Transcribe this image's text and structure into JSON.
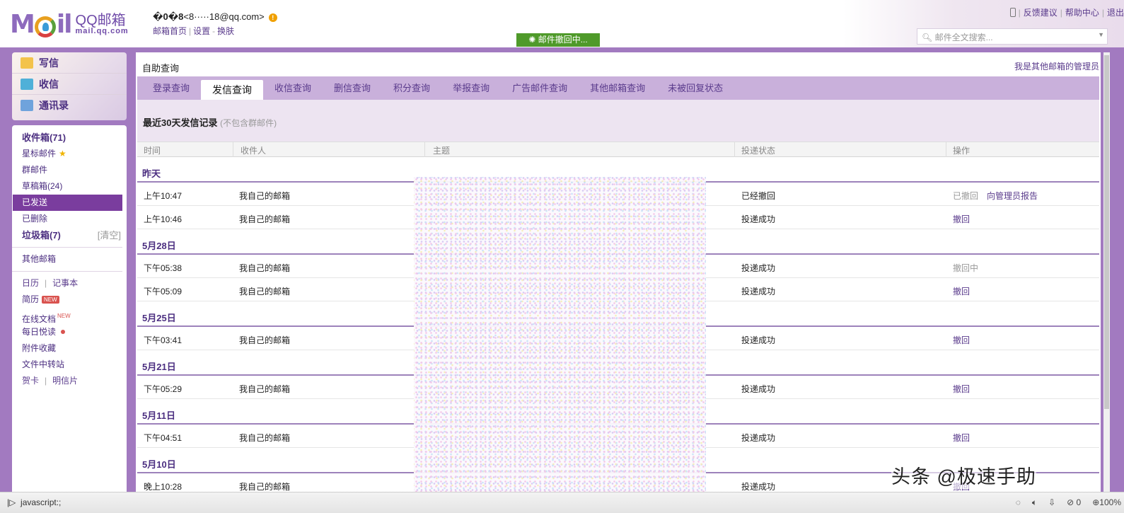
{
  "header": {
    "logo_main": "MOil",
    "logo_title": "QQ邮箱",
    "logo_domain": "mail.qq.com",
    "user_name": "�0�8",
    "user_email": "<8·····18@qq.com>",
    "links": [
      "邮箱首页",
      "设置",
      "换肤"
    ],
    "top_links": [
      "反馈建议",
      "帮助中心",
      "退出"
    ],
    "search_placeholder": "邮件全文搜索...",
    "toast": "邮件撤回中..."
  },
  "sidebar": {
    "quick": [
      "写信",
      "收信",
      "通讯录"
    ],
    "inbox": "收件箱(71)",
    "starred": "星标邮件",
    "group": "群邮件",
    "drafts": "草稿箱(24)",
    "sent": "已发送",
    "deleted": "已删除",
    "spam": "垃圾箱(7)",
    "spam_clear": "[清空]",
    "other": "其他邮箱",
    "calendar": "日历",
    "notes": "记事本",
    "resume": "简历",
    "new": "NEW",
    "docs": "在线文档",
    "daily": "每日悦读",
    "attachments": "附件收藏",
    "transfer": "文件中转站",
    "cards": "贺卡",
    "postcards": "明信片"
  },
  "main": {
    "title": "自助查询",
    "admin_link": "我是其他邮箱的管理员",
    "tabs": [
      "登录查询",
      "发信查询",
      "收信查询",
      "删信查询",
      "积分查询",
      "举报查询",
      "广告邮件查询",
      "其他邮箱查询",
      "未被回复状态"
    ],
    "section_title": "最近30天发信记录",
    "section_note": "(不包含群邮件)",
    "columns": [
      "时间",
      "收件人",
      "主题",
      "投递状态",
      "操作"
    ],
    "groups": [
      {
        "date": "昨天",
        "rows": [
          {
            "time": "上午10:47",
            "to": "我自己的邮箱",
            "status": "已经撤回",
            "action": "已撤回",
            "action2": "向管理员报告"
          },
          {
            "time": "上午10:46",
            "to": "我自己的邮箱",
            "status": "投递成功",
            "action": "撤回"
          }
        ]
      },
      {
        "date": "5月28日",
        "rows": [
          {
            "time": "下午05:38",
            "to": "我自己的邮箱",
            "status": "投递成功",
            "action": "撤回中"
          },
          {
            "time": "下午05:09",
            "to": "我自己的邮箱",
            "status": "投递成功",
            "action": "撤回"
          }
        ]
      },
      {
        "date": "5月25日",
        "rows": [
          {
            "time": "下午03:41",
            "to": "我自己的邮箱",
            "status": "投递成功",
            "action": "撤回"
          }
        ]
      },
      {
        "date": "5月21日",
        "rows": [
          {
            "time": "下午05:29",
            "to": "我自己的邮箱",
            "status": "投递成功",
            "action": "撤回"
          }
        ]
      },
      {
        "date": "5月11日",
        "rows": [
          {
            "time": "下午04:51",
            "to": "我自己的邮箱",
            "status": "投递成功",
            "action": "撤回"
          }
        ]
      },
      {
        "date": "5月10日",
        "rows": [
          {
            "time": "晚上10:28",
            "to": "我自己的邮箱",
            "status": "投递成功",
            "action": "撤回"
          }
        ]
      }
    ]
  },
  "watermark": "头条 @极速手助",
  "statusbar": {
    "text": "javascript:;",
    "count": "0",
    "zoom": "100%"
  }
}
